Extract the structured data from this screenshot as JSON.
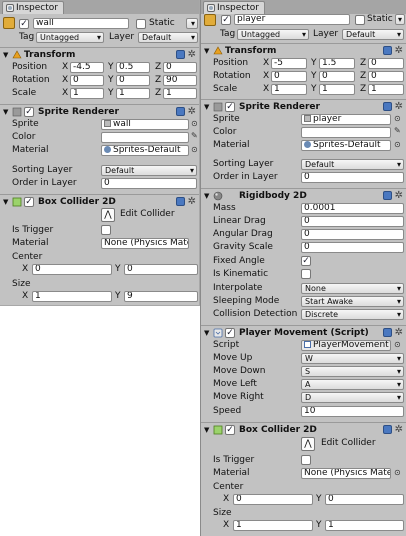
{
  "left": {
    "tab_title": "Inspector",
    "object_name": "wall",
    "static_label": "Static",
    "tag_label": "Tag",
    "tag_value": "Untagged",
    "layer_label": "Layer",
    "layer_value": "Default",
    "transform": {
      "title": "Transform",
      "position_label": "Position",
      "pos_x": "-4.5",
      "pos_y": "0.5",
      "pos_z": "0",
      "rotation_label": "Rotation",
      "rot_x": "0",
      "rot_y": "0",
      "rot_z": "90",
      "scale_label": "Scale",
      "scl_x": "1",
      "scl_y": "1",
      "scl_z": "1"
    },
    "sprite_renderer": {
      "title": "Sprite Renderer",
      "sprite_label": "Sprite",
      "sprite_value": "wall",
      "color_label": "Color",
      "material_label": "Material",
      "material_value": "Sprites-Default",
      "sorting_layer_label": "Sorting Layer",
      "sorting_layer_value": "Default",
      "order_label": "Order in Layer",
      "order_value": "0"
    },
    "box_collider": {
      "title": "Box Collider 2D",
      "edit_label": "Edit Collider",
      "trigger_label": "Is Trigger",
      "material_label": "Material",
      "material_value": "None (Physics Mater",
      "center_label": "Center",
      "center_x": "0",
      "center_y": "0",
      "size_label": "Size",
      "size_x": "1",
      "size_y": "9"
    }
  },
  "right": {
    "tab_title": "Inspector",
    "object_name": "player",
    "static_label": "Static",
    "tag_label": "Tag",
    "tag_value": "Untagged",
    "layer_label": "Layer",
    "layer_value": "Default",
    "transform": {
      "title": "Transform",
      "position_label": "Position",
      "pos_x": "-5",
      "pos_y": "1.5",
      "pos_z": "0",
      "rotation_label": "Rotation",
      "rot_x": "0",
      "rot_y": "0",
      "rot_z": "0",
      "scale_label": "Scale",
      "scl_x": "1",
      "scl_y": "1",
      "scl_z": "1"
    },
    "sprite_renderer": {
      "title": "Sprite Renderer",
      "sprite_label": "Sprite",
      "sprite_value": "player",
      "color_label": "Color",
      "material_label": "Material",
      "material_value": "Sprites-Default",
      "sorting_layer_label": "Sorting Layer",
      "sorting_layer_value": "Default",
      "order_label": "Order in Layer",
      "order_value": "0"
    },
    "rigidbody": {
      "title": "Rigidbody 2D",
      "mass_label": "Mass",
      "mass_value": "0.0001",
      "linear_drag_label": "Linear Drag",
      "linear_drag_value": "0",
      "angular_drag_label": "Angular Drag",
      "angular_drag_value": "0",
      "gravity_label": "Gravity Scale",
      "gravity_value": "0",
      "fixed_angle_label": "Fixed Angle",
      "kinematic_label": "Is Kinematic",
      "interpolate_label": "Interpolate",
      "interpolate_value": "None",
      "sleeping_label": "Sleeping Mode",
      "sleeping_value": "Start Awake",
      "collision_label": "Collision Detection",
      "collision_value": "Discrete"
    },
    "player_movement": {
      "title": "Player Movement (Script)",
      "script_label": "Script",
      "script_value": "PlayerMovement",
      "up_label": "Move Up",
      "up_value": "W",
      "down_label": "Move Down",
      "down_value": "S",
      "left_label": "Move Left",
      "left_value": "A",
      "right_label": "Move Right",
      "right_value": "D",
      "speed_label": "Speed",
      "speed_value": "10"
    },
    "box_collider": {
      "title": "Box Collider 2D",
      "edit_label": "Edit Collider",
      "trigger_label": "Is Trigger",
      "material_label": "Material",
      "material_value": "None (Physics Mater",
      "center_label": "Center",
      "center_x": "0",
      "center_y": "0",
      "size_label": "Size",
      "size_x": "1",
      "size_y": "1"
    }
  },
  "axis": {
    "x": "X",
    "y": "Y",
    "z": "Z"
  },
  "check_mark": "✓",
  "icons": {
    "book": "help-book-icon",
    "gear": "gear-icon",
    "picker": "eyedropper-icon",
    "edit": "edit-collider-icon"
  }
}
